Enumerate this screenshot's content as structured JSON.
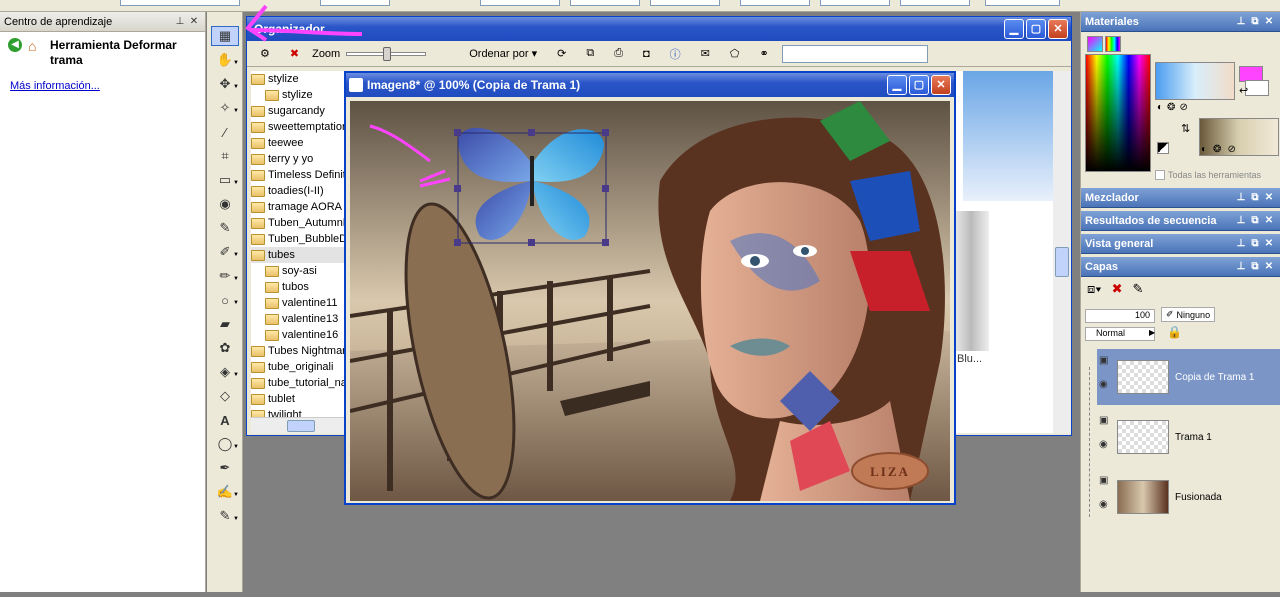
{
  "learning_center": {
    "title": "Centro de aprendizaje",
    "heading": "Herramienta Deformar trama",
    "more_info": "Más información..."
  },
  "organizer": {
    "title": "Organizador",
    "zoom_label": "Zoom",
    "sort_label": "Ordenar por",
    "folders": [
      {
        "name": "stylize",
        "indent": 0
      },
      {
        "name": "stylize",
        "indent": 1
      },
      {
        "name": "sugarcandy",
        "indent": 0
      },
      {
        "name": "sweettemptation",
        "indent": 0
      },
      {
        "name": "teewee",
        "indent": 0
      },
      {
        "name": "terry y yo",
        "indent": 0
      },
      {
        "name": "Timeless Definition",
        "indent": 0
      },
      {
        "name": "toadies(I-II)",
        "indent": 0
      },
      {
        "name": "tramage AORA",
        "indent": 0
      },
      {
        "name": "Tuben_AutumnM",
        "indent": 0
      },
      {
        "name": "Tuben_BubbleDr",
        "indent": 0
      },
      {
        "name": "tubes",
        "indent": 0
      },
      {
        "name": "soy-asi",
        "indent": 1
      },
      {
        "name": "tubos",
        "indent": 1
      },
      {
        "name": "valentine11",
        "indent": 1
      },
      {
        "name": "valentine13",
        "indent": 1
      },
      {
        "name": "valentine16",
        "indent": 1
      },
      {
        "name": "Tubes Nightmare",
        "indent": 0
      },
      {
        "name": "tube_originali",
        "indent": 0
      },
      {
        "name": "tube_tutorial_na",
        "indent": 0
      },
      {
        "name": "tublet",
        "indent": 0
      },
      {
        "name": "twilight",
        "indent": 0
      }
    ],
    "thumb_caption": "Blu..."
  },
  "image_window": {
    "title": "Imagen8* @ 100% (Copia de Trama 1)",
    "watermark": "LIZA"
  },
  "materials": {
    "title": "Materiales",
    "all_tools_label": "Todas las herramientas",
    "foreground_color": "#ff44ff",
    "background_color": "#ffffff"
  },
  "panels": {
    "mixer": "Mezclador",
    "script_results": "Resultados de secuencia",
    "overview": "Vista general",
    "layers": "Capas"
  },
  "layers": {
    "opacity": "100",
    "mask_label": "Ninguno",
    "blend_mode": "Normal",
    "items": [
      {
        "name": "Copia de Trama 1",
        "selected": true
      },
      {
        "name": "Trama 1",
        "selected": false
      },
      {
        "name": "Fusionada",
        "selected": false
      }
    ]
  },
  "colors": {
    "titlebar_blue": "#2b56c9",
    "panel_title_blue": "#4a73b8",
    "annotation_magenta": "#ff44ff"
  }
}
